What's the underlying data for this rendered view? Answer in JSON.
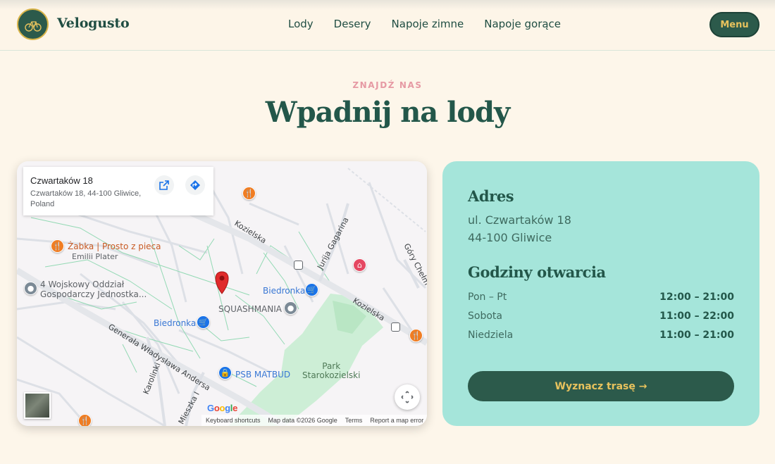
{
  "header": {
    "brand": "Velogusto",
    "logo_text": "VELO GUSTO",
    "nav": [
      "Lody",
      "Desery",
      "Napoje zimne",
      "Napoje gorące"
    ],
    "menu_label": "Menu"
  },
  "section": {
    "eyebrow": "ZNAJDŹ NAS",
    "title": "Wpadnij na lody"
  },
  "map": {
    "place_name": "Czwartaków 18",
    "place_address": "Czwartaków 18, 44-100 Gliwice, Poland",
    "labels": {
      "zabka": "Żabka | Prosto z pieca",
      "emilii": "Emilii Plater",
      "wojskowy": "4 Wojskowy Oddział\nGospodarczy Jednostka...",
      "biedronka1": "Biedronka",
      "biedronka2": "Biedronka",
      "squash": "SQUASHMANIA",
      "psb": "PSB MATBUD",
      "park": "Park\nStarokozielski",
      "kozielska1": "Kozielska",
      "kozielska2": "Kozielska",
      "gagarina": "Jurija Gagarina",
      "gory": "Góry Chełm",
      "andersa": "Generała Władysława Andersa",
      "karolinki": "Karolinki",
      "mieszka": "Mieszka I"
    },
    "google": "Google",
    "attribution": [
      "Keyboard shortcuts",
      "Map data ©2026 Google",
      "Terms",
      "Report a map error"
    ]
  },
  "info": {
    "address_heading": "Adres",
    "address_lines": [
      "ul. Czwartaków 18",
      "44-100 Gliwice"
    ],
    "hours_heading": "Godziny otwarcia",
    "hours": [
      {
        "day": "Pon – Pt",
        "time": "12:00 – 21:00"
      },
      {
        "day": "Sobota",
        "time": "11:00 – 22:00"
      },
      {
        "day": "Niedziela",
        "time": "11:00 – 21:00"
      }
    ],
    "route_button": "Wyznacz trasę →"
  },
  "colors": {
    "background": "#fdf6ea",
    "primary": "#2c5a4b",
    "accent": "#e7c25d",
    "panel": "#a5e5da",
    "eyebrow": "#e69aa4"
  }
}
